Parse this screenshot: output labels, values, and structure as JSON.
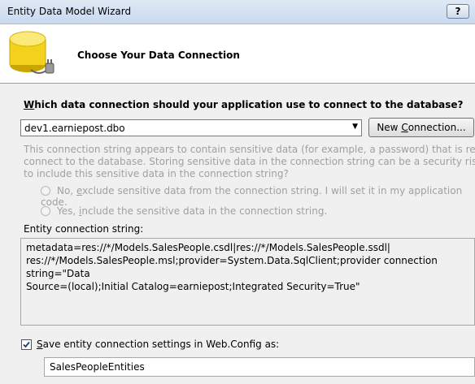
{
  "window": {
    "title": "Entity Data Model Wizard",
    "help_label": "?"
  },
  "header": {
    "heading": "Choose Your Data Connection",
    "icon": "database-plug-icon"
  },
  "question": {
    "accel": "W",
    "rest": "hich data connection should your application use to connect to the database?"
  },
  "connection": {
    "selected": "dev1.earniepost.dbo",
    "new_label_prefix": "New ",
    "new_label_accel": "C",
    "new_label_suffix": "onnection..."
  },
  "sensitive_note": {
    "line1": "This connection string appears to contain sensitive data (for example, a password) that is required to",
    "line2": "connect to the database. Storing sensitive data in the connection string can be a security risk. Do you want",
    "line3": "to include this sensitive data in the connection string?"
  },
  "options": {
    "exclude": {
      "pre": "No, ",
      "accel": "e",
      "post": "xclude sensitive data from the connection string. I will set it in my application code."
    },
    "include": {
      "pre": "Yes, ",
      "accel": "i",
      "post": "nclude the sensitive data in the connection string."
    }
  },
  "entity_string": {
    "label": "Entity connection string:",
    "line1": "metadata=res://*/Models.SalesPeople.csdl|res://*/Models.SalesPeople.ssdl|",
    "line2": "res://*/Models.SalesPeople.msl;provider=System.Data.SqlClient;provider connection string=\"Data",
    "line3": "Source=(local);Initial Catalog=earniepost;Integrated Security=True\""
  },
  "save": {
    "checked": true,
    "accel": "S",
    "rest": "ave entity connection settings in Web.Config as:",
    "value": "SalesPeopleEntities"
  },
  "colors": {
    "disabled_text": "#a0a0a0",
    "title_bar": "#d3e0f1"
  }
}
